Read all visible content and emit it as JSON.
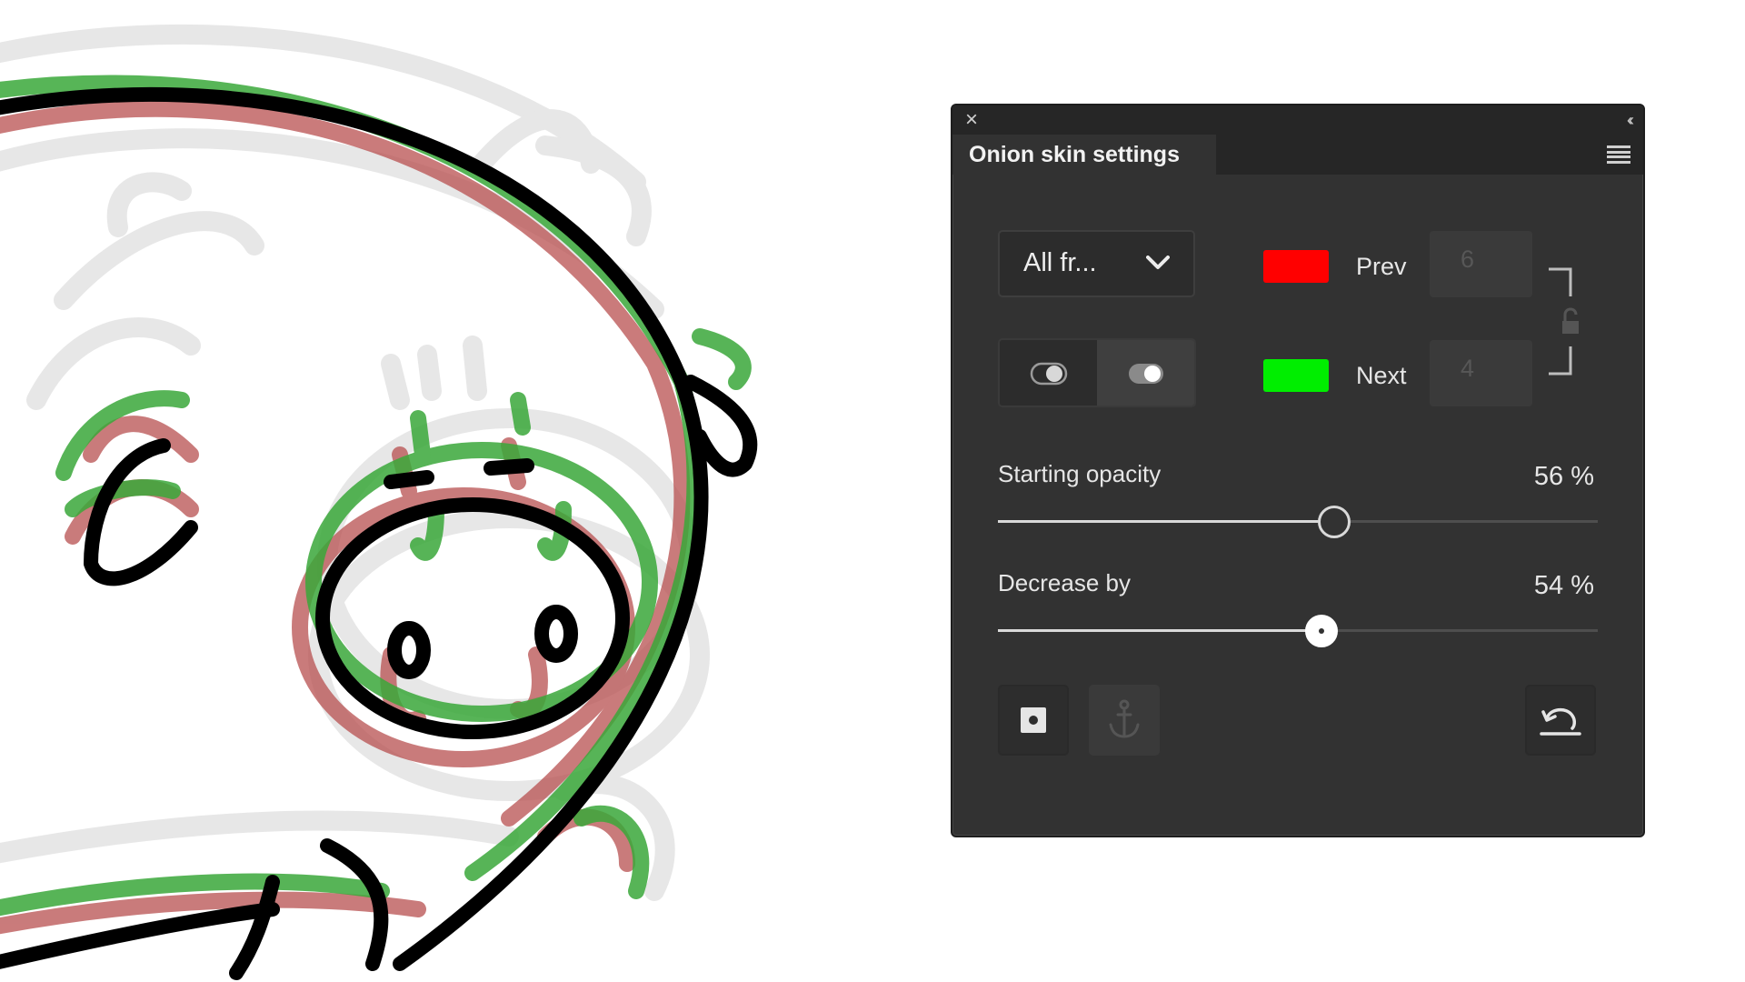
{
  "panel": {
    "title": "Onion skin settings",
    "mode_dropdown": {
      "selected": "All fr..."
    },
    "prev": {
      "label": "Prev",
      "color": "#ff0000",
      "frames": "6"
    },
    "next": {
      "label": "Next",
      "color": "#00ee00",
      "frames": "4"
    },
    "starting_opacity": {
      "label": "Starting opacity",
      "value_text": "56 %",
      "value": 56
    },
    "decrease_by": {
      "label": "Decrease by",
      "value_text": "54 %",
      "value": 54
    },
    "icons": {
      "close": "close-icon",
      "collapse": "collapse-icon",
      "menu": "hamburger-menu-icon",
      "dropdown": "chevron-down-icon",
      "link": "link-lock-icon",
      "outline_toggle": "toggle-outline-icon",
      "filled_toggle": "toggle-filled-icon",
      "keyframe": "keyframe-icon",
      "anchor": "anchor-icon",
      "reset": "reset-icon"
    }
  },
  "colors": {
    "panel_bg": "#323232",
    "prev_tint": "#b84f4f",
    "next_tint": "#3aa83a",
    "ghost": "#d0d0d0",
    "outline": "#000000"
  }
}
